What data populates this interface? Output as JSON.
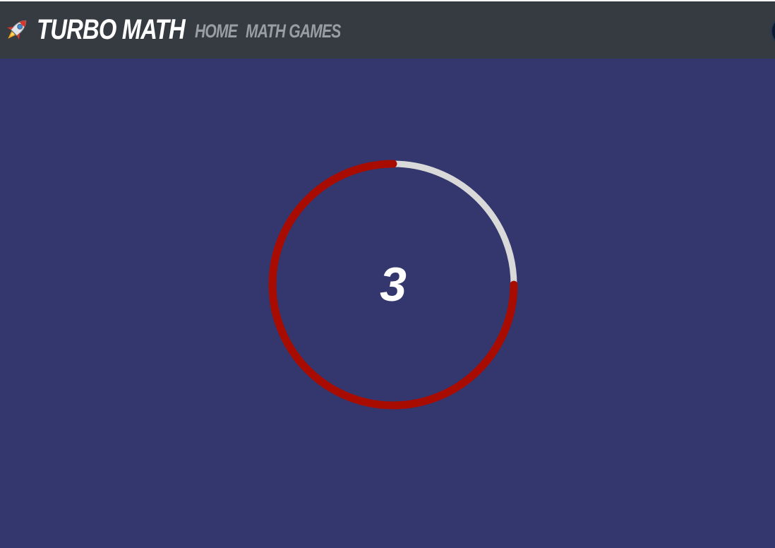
{
  "header": {
    "logo_icon": "rocket-icon",
    "brand": "TURBO MATH",
    "nav": [
      {
        "label": "HOME"
      },
      {
        "label": "MATH GAMES"
      }
    ],
    "avatar_icon": "user-avatar"
  },
  "timer": {
    "count": "3",
    "progress_fraction": 0.75,
    "progress_color": "#a80c00",
    "track_color": "#d9d9d9",
    "background_color": "#34366e"
  }
}
